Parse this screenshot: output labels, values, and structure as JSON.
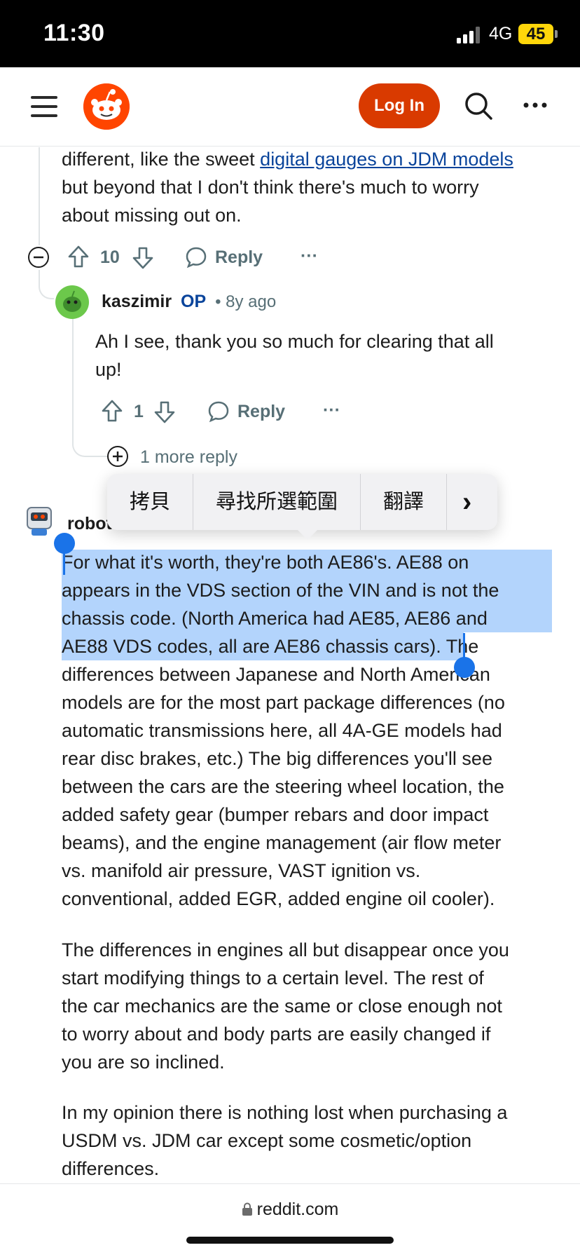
{
  "status_bar": {
    "time": "11:30",
    "network": "4G",
    "battery": "45"
  },
  "header": {
    "login_label": "Log In"
  },
  "comment_prev": {
    "text_before_link": "different, like the sweet ",
    "link_text": "digital gauges on JDM models",
    "line2": "but beyond that I don't think there's much to worry",
    "line3": "about missing out on.",
    "votes": "10",
    "reply_label": "Reply",
    "more": "···"
  },
  "reply_comment": {
    "author": "kaszimir",
    "op_badge": "OP",
    "age": "• 8y ago",
    "line1": "Ah I see, thank you so much for clearing that all",
    "line2": "up!",
    "votes": "1",
    "reply_label": "Reply",
    "more": "···"
  },
  "more_replies": {
    "label": "1 more reply"
  },
  "context_menu": {
    "items": [
      "拷貝",
      "尋找所選範圍",
      "翻譯"
    ],
    "next": "›"
  },
  "main_comment": {
    "author_visible": "robot",
    "lines": [
      "For what it's worth, they're both AE86's. AE88 on",
      "appears in the VDS section of the VIN and is not the",
      "chassis code. (North America had AE85, AE86 and",
      "AE88 VDS codes, all are AE86 chassis cars).",
      " The",
      "differences between Japanese and North American",
      "models are for the most part package differences (no",
      "automatic transmissions here, all 4A-GE models had",
      "rear disc brakes, etc.) The big differences you'll see",
      "between the cars are the steering wheel location, the",
      "added safety gear (bumper rebars and door impact",
      "beams), and the engine management (air flow meter",
      "vs. manifold air pressure, VAST ignition vs.",
      "conventional, added EGR, added engine oil cooler)."
    ],
    "para2": [
      "The differences in engines all but disappear once you",
      "start modifying things to a certain level. The rest of",
      "the car mechanics are the same or close enough not",
      "to worry about and body parts are easily changed if",
      "you are so inclined."
    ],
    "para3": [
      "In my opinion there is nothing lost when purchasing a",
      "USDM vs. JDM car except some cosmetic/option",
      "differences."
    ]
  },
  "bottom_bar": {
    "url": "reddit.com"
  },
  "colors": {
    "accent": "#d93a00",
    "selection": "#b3d4fc",
    "handle": "#1a73e8",
    "op": "#0a449b"
  }
}
